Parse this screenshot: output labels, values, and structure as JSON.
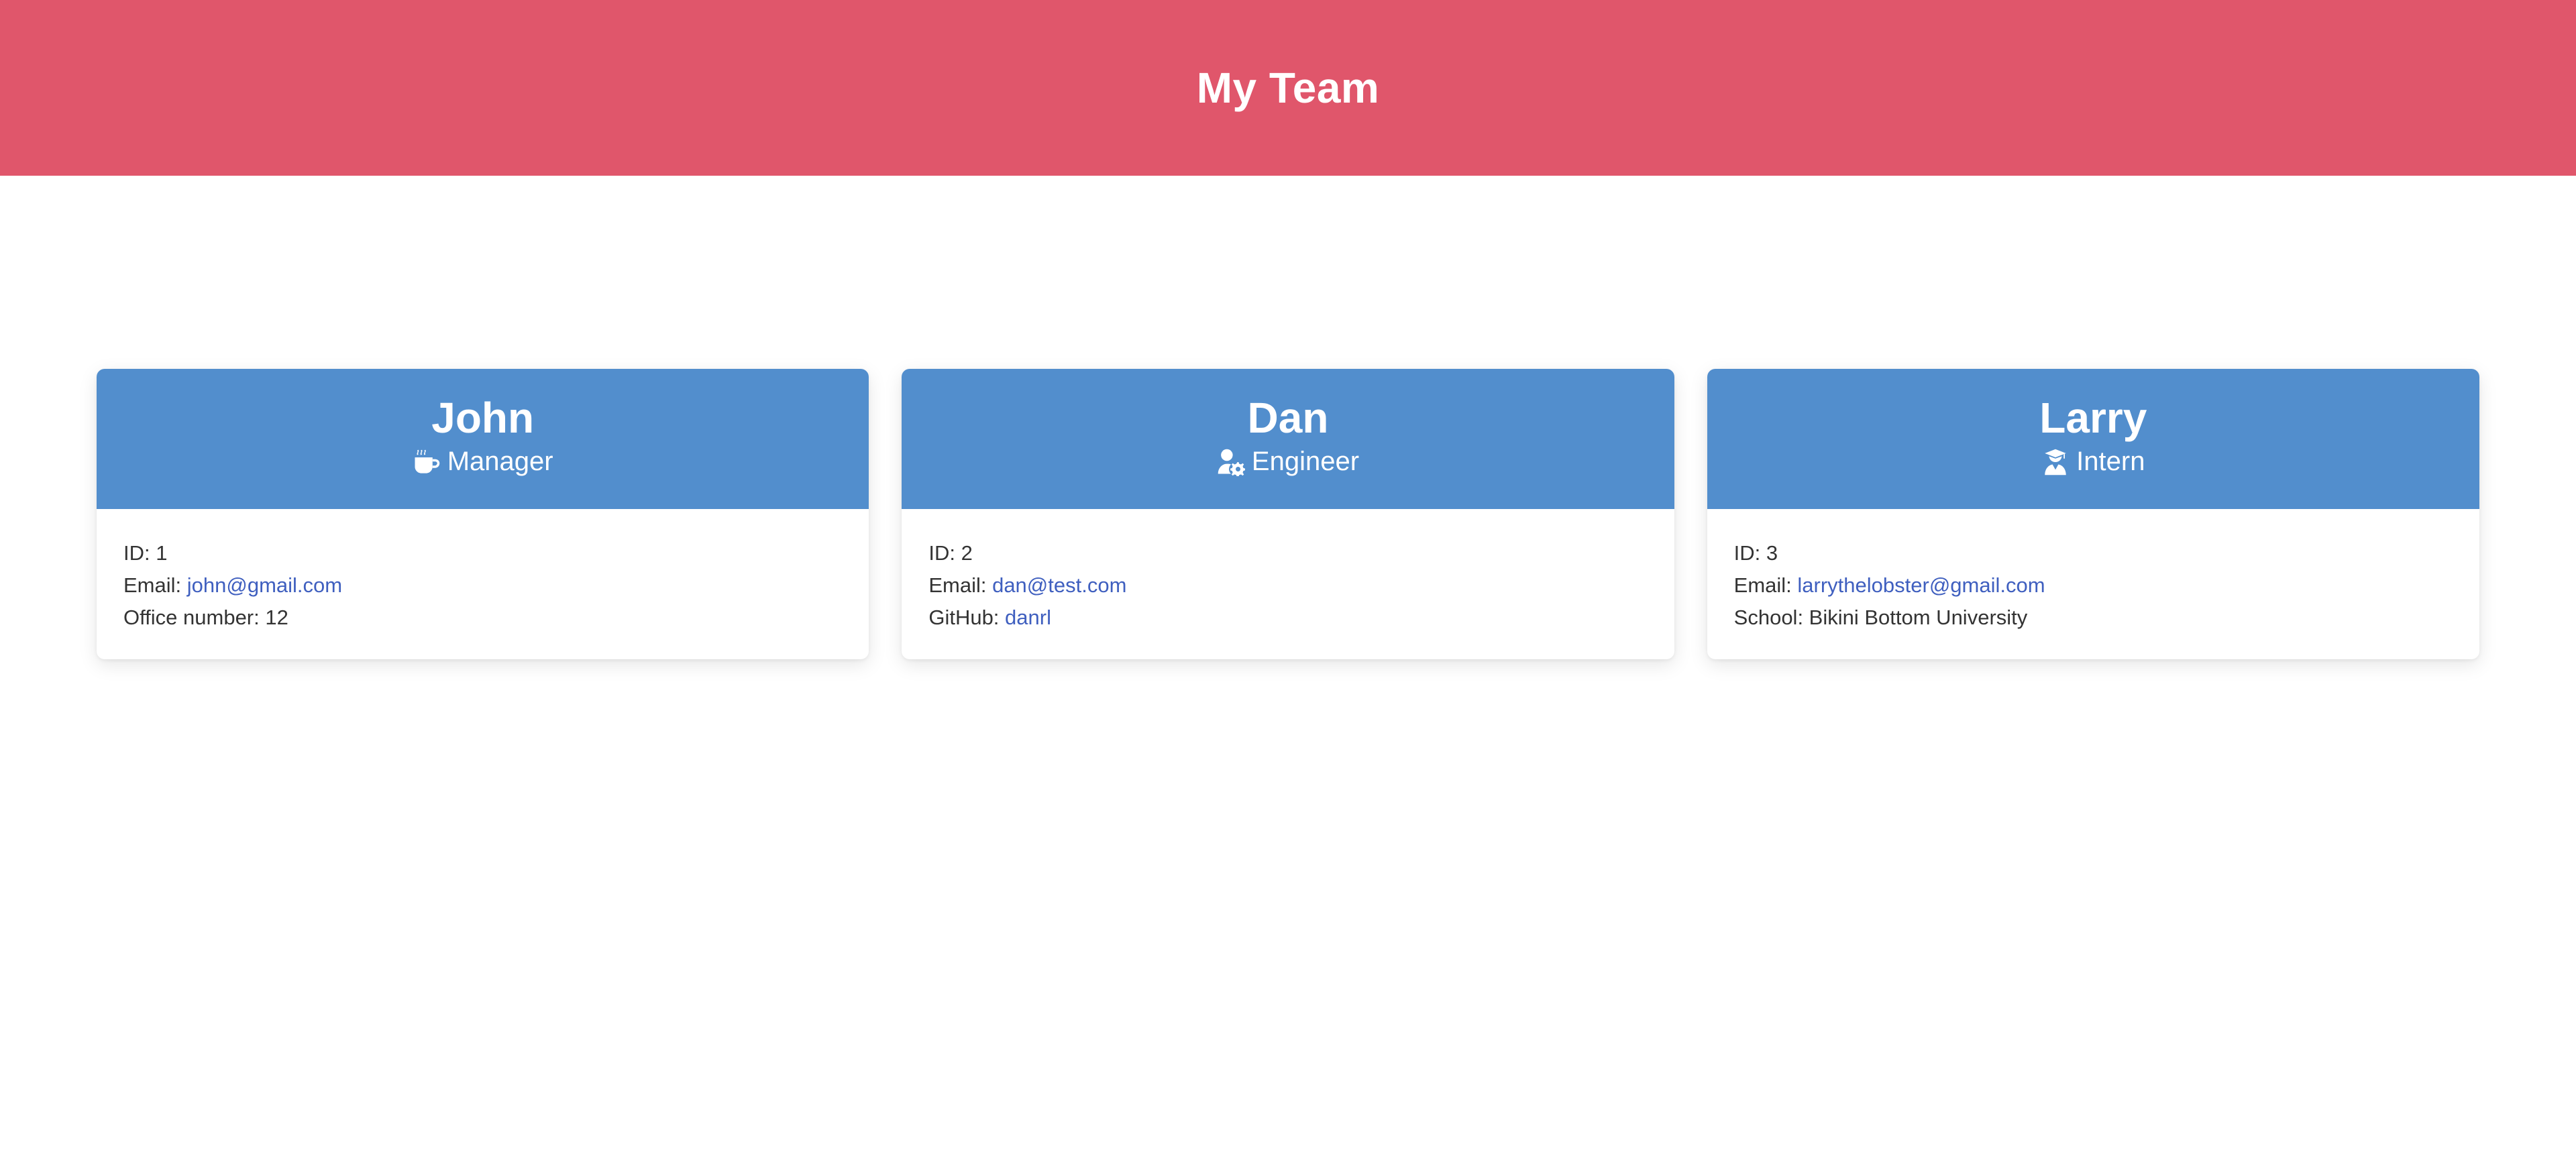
{
  "header": {
    "title": "My Team"
  },
  "colors": {
    "header_bg": "#e0566b",
    "card_head_bg": "#528ecd",
    "link": "#3f5fbf"
  },
  "cards": [
    {
      "name": "John",
      "role": "Manager",
      "role_icon": "mug-hot-icon",
      "id_label": "ID: ",
      "id": "1",
      "email_label": "Email: ",
      "email": "john@gmail.com",
      "extra_label": "Office number: ",
      "extra_value": "12"
    },
    {
      "name": "Dan",
      "role": "Engineer",
      "role_icon": "user-gear-icon",
      "id_label": "ID: ",
      "id": "2",
      "email_label": "Email: ",
      "email": "dan@test.com",
      "extra_label": "GitHub: ",
      "extra_value": "danrl"
    },
    {
      "name": "Larry",
      "role": "Intern",
      "role_icon": "user-graduate-icon",
      "id_label": "ID: ",
      "id": "3",
      "email_label": "Email: ",
      "email": "larrythelobster@gmail.com",
      "extra_label": "School: ",
      "extra_value": "Bikini Bottom University"
    }
  ]
}
